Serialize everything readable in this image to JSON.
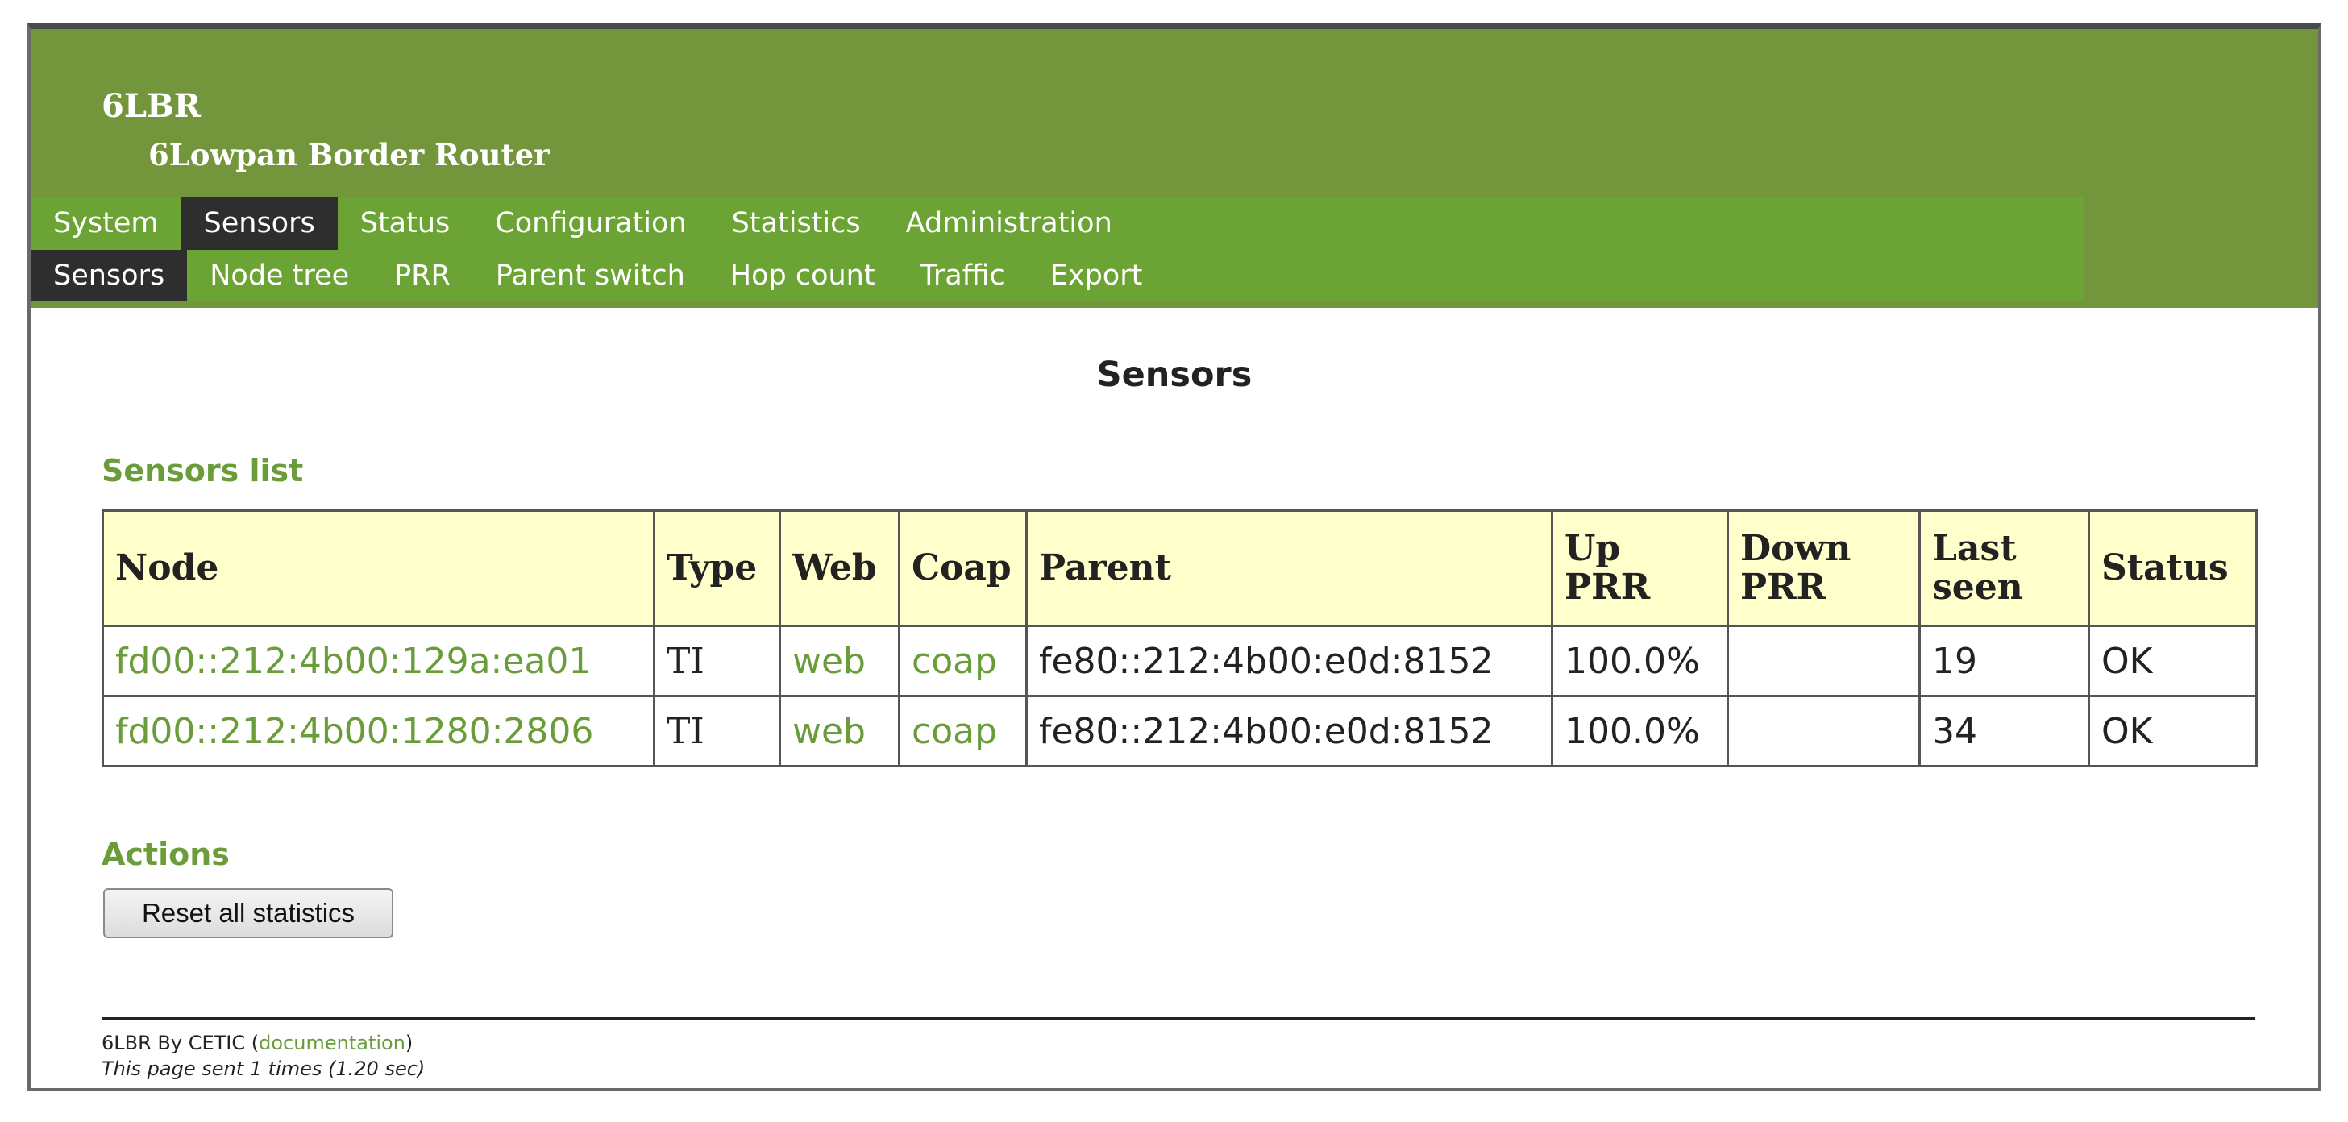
{
  "header": {
    "title": "6LBR",
    "subtitle": "6Lowpan Border Router"
  },
  "main_menu": [
    "System",
    "Sensors",
    "Status",
    "Configuration",
    "Statistics",
    "Administration"
  ],
  "main_menu_active": "Sensors",
  "sub_menu": [
    "Sensors",
    "Node tree",
    "PRR",
    "Parent switch",
    "Hop count",
    "Traffic",
    "Export"
  ],
  "sub_menu_active": "Sensors",
  "page_title": "Sensors",
  "sensors_list": {
    "title": "Sensors list",
    "columns": [
      "Node",
      "Type",
      "Web",
      "Coap",
      "Parent",
      "Up PRR",
      "Down PRR",
      "Last seen",
      "Status"
    ],
    "rows": [
      {
        "node": "fd00::212:4b00:129a:ea01",
        "type": "TI",
        "web": "web",
        "coap": "coap",
        "parent": "fe80::212:4b00:e0d:8152",
        "up_prr": "100.0%",
        "down_prr": "",
        "last_seen": "19",
        "status": "OK"
      },
      {
        "node": "fd00::212:4b00:1280:2806",
        "type": "TI",
        "web": "web",
        "coap": "coap",
        "parent": "fe80::212:4b00:e0d:8152",
        "up_prr": "100.0%",
        "down_prr": "",
        "last_seen": "34",
        "status": "OK"
      }
    ]
  },
  "actions": {
    "title": "Actions",
    "reset_label": "Reset all statistics"
  },
  "footer": {
    "credit": "6LBR By CETIC",
    "doc_open": "(",
    "doc_link": "documentation",
    "doc_close": ")",
    "sent_info": "This page sent 1 times (1.20 sec)"
  },
  "colors": {
    "header_bg": "#73963d",
    "menu_bg": "#6ba334",
    "active_tab": "#2e2e2e",
    "link": "#6a9d3a",
    "table_header_bg": "#ffffcc"
  }
}
